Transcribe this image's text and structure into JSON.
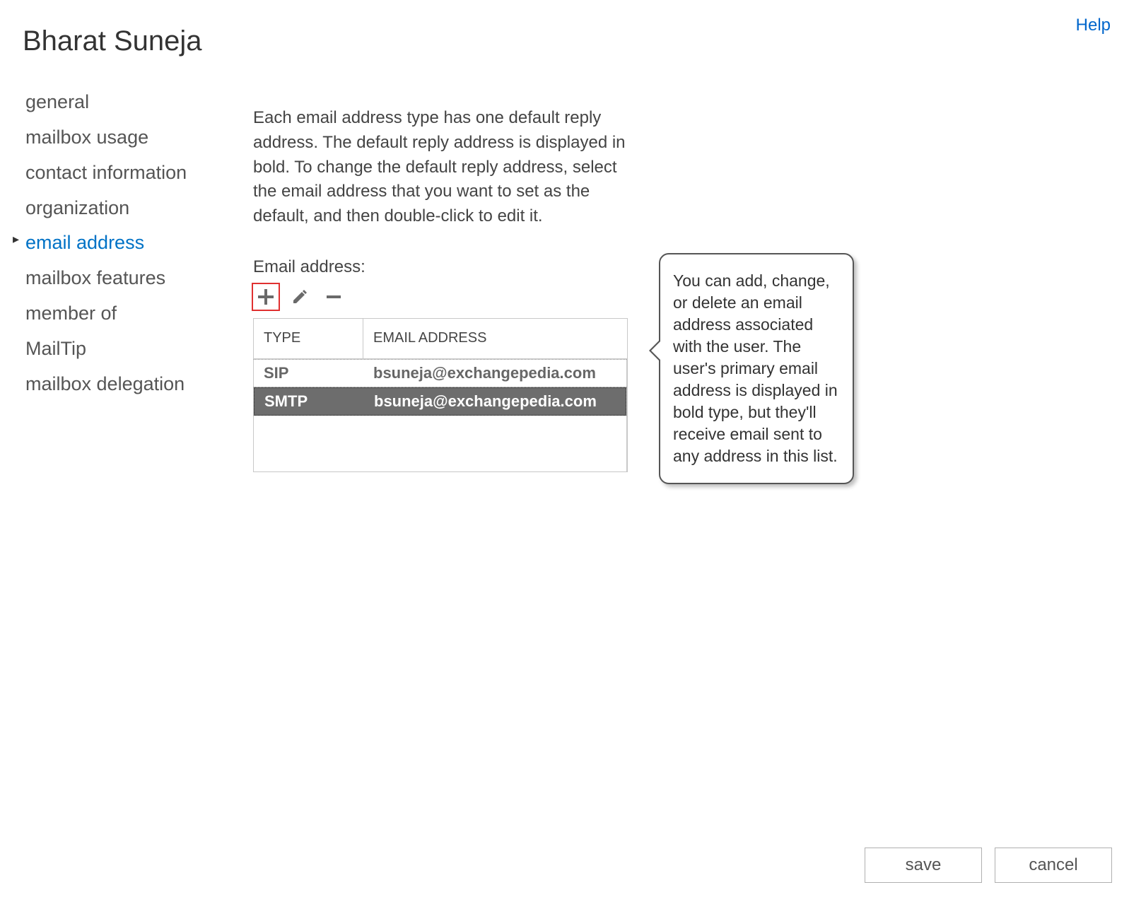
{
  "header": {
    "title": "Bharat Suneja",
    "help_label": "Help"
  },
  "sidebar": {
    "items": [
      {
        "label": "general",
        "active": false
      },
      {
        "label": "mailbox usage",
        "active": false
      },
      {
        "label": "contact information",
        "active": false
      },
      {
        "label": "organization",
        "active": false
      },
      {
        "label": "email address",
        "active": true
      },
      {
        "label": "mailbox features",
        "active": false
      },
      {
        "label": "member of",
        "active": false
      },
      {
        "label": "MailTip",
        "active": false
      },
      {
        "label": "mailbox delegation",
        "active": false
      }
    ]
  },
  "main": {
    "description": "Each email address type has one default reply address. The default reply address is displayed in bold. To change the default reply address, select the email address that you want to set as the default, and then double-click to edit it.",
    "section_label": "Email address:",
    "columns": {
      "type": "TYPE",
      "address": "EMAIL ADDRESS"
    },
    "rows": [
      {
        "type": "SIP",
        "address": "bsuneja@exchangepedia.com",
        "selected": false,
        "primary": false
      },
      {
        "type": "SMTP",
        "address": "bsuneja@exchangepedia.com",
        "selected": true,
        "primary": true
      }
    ]
  },
  "callout": {
    "text": "You can add, change, or delete an email address associated with the user. The user's primary email address is displayed in bold type, but they'll receive email sent to any address in this list."
  },
  "footer": {
    "save_label": "save",
    "cancel_label": "cancel"
  }
}
